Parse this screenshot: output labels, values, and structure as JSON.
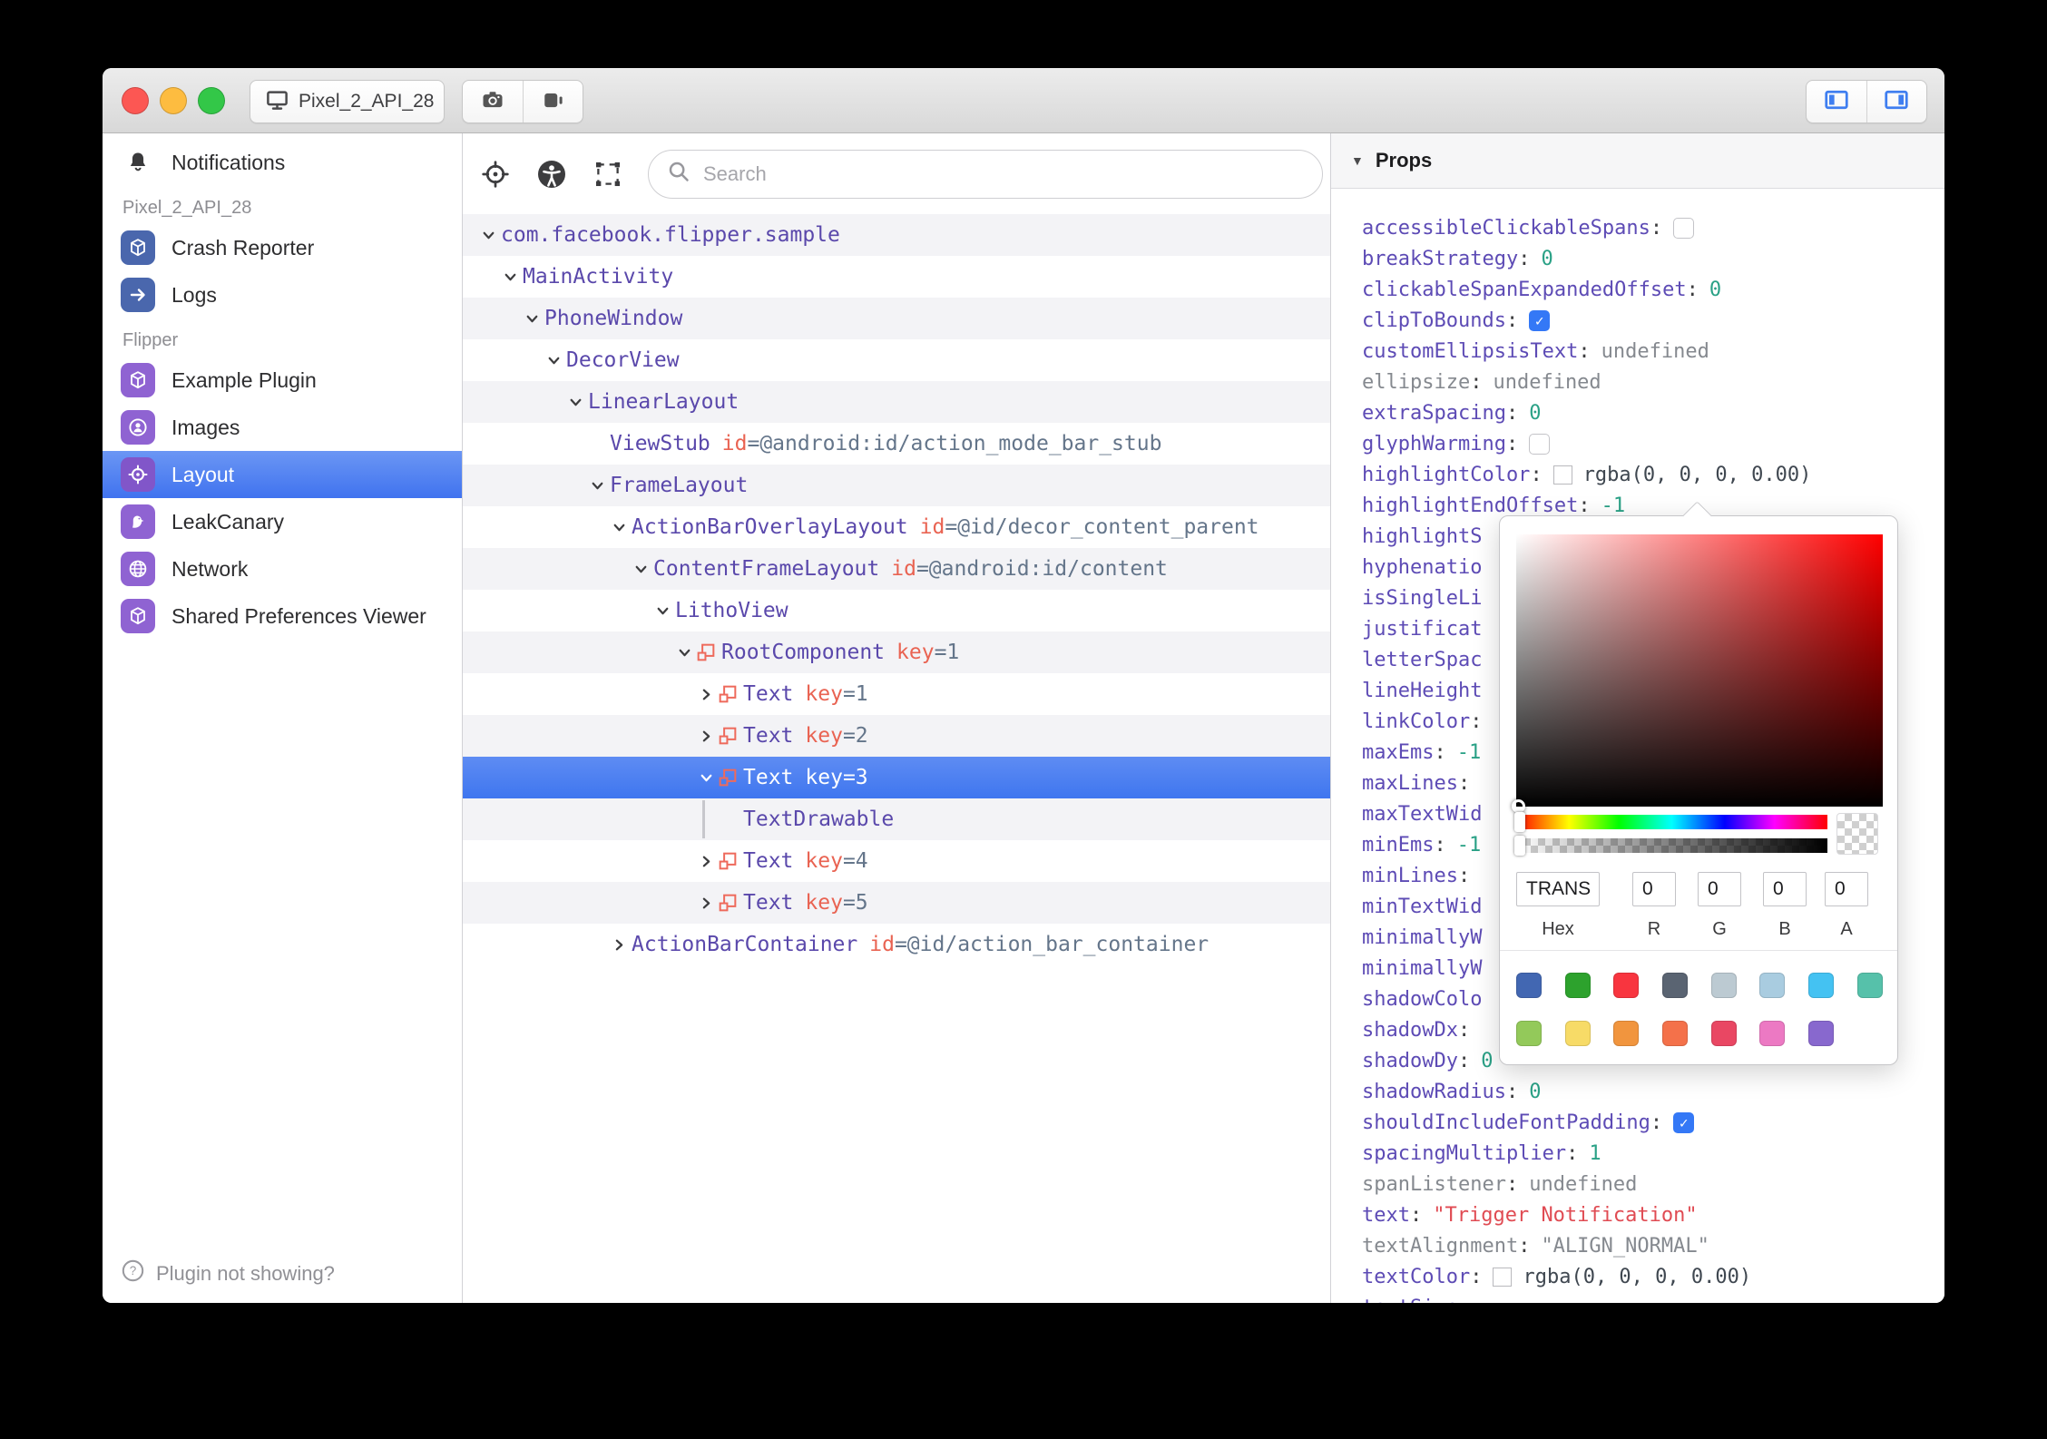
{
  "window": {
    "title_button": "Pixel_2_API_28",
    "traffic_lights": [
      "close",
      "minimize",
      "zoom"
    ],
    "titlebar_icons": [
      "camera-icon",
      "video-camera-icon"
    ],
    "panel_toggles": [
      "toggle-left-panel-icon",
      "toggle-right-panel-icon"
    ]
  },
  "sidebar": {
    "notifications_label": "Notifications",
    "device_section": "Pixel_2_API_28",
    "device_plugins": [
      {
        "label": "Crash Reporter",
        "icon": "cube-icon",
        "color": "#4a67ad"
      },
      {
        "label": "Logs",
        "icon": "arrow-right-icon",
        "color": "#4a67ad"
      }
    ],
    "flipper_section": "Flipper",
    "flipper_plugins": [
      {
        "label": "Example Plugin",
        "icon": "cube-icon",
        "color": "#8f63d2"
      },
      {
        "label": "Images",
        "icon": "person-circle-icon",
        "color": "#8f63d2"
      },
      {
        "label": "Layout",
        "icon": "target-icon",
        "color": "#8156c9",
        "selected": true
      },
      {
        "label": "LeakCanary",
        "icon": "bird-icon",
        "color": "#8f63d2"
      },
      {
        "label": "Network",
        "icon": "globe-icon",
        "color": "#8f63d2"
      },
      {
        "label": "Shared Preferences Viewer",
        "icon": "cube-icon",
        "color": "#8f63d2"
      }
    ],
    "footer": "Plugin not showing?"
  },
  "inspector": {
    "toolbar_icons": [
      "crosshair-icon",
      "accessibility-icon",
      "select-area-icon"
    ],
    "search_placeholder": "Search",
    "tree": [
      {
        "name": "com.facebook.flipper.sample",
        "depth": 0,
        "chevron": "down"
      },
      {
        "name": "MainActivity",
        "depth": 1,
        "chevron": "down"
      },
      {
        "name": "PhoneWindow",
        "depth": 2,
        "chevron": "down"
      },
      {
        "name": "DecorView",
        "depth": 3,
        "chevron": "down"
      },
      {
        "name": "LinearLayout",
        "depth": 4,
        "chevron": "down"
      },
      {
        "name": "ViewStub",
        "depth": 5,
        "chevron": "none",
        "attrs": [
          {
            "key": "id",
            "value": "=@android:id/action_mode_bar_stub"
          }
        ]
      },
      {
        "name": "FrameLayout",
        "depth": 5,
        "chevron": "down"
      },
      {
        "name": "ActionBarOverlayLayout",
        "depth": 6,
        "chevron": "down",
        "attrs": [
          {
            "key": "id",
            "value": "=@id/decor_content_parent"
          }
        ]
      },
      {
        "name": "ContentFrameLayout",
        "depth": 7,
        "chevron": "down",
        "attrs": [
          {
            "key": "id",
            "value": "=@android:id/content"
          }
        ]
      },
      {
        "name": "LithoView",
        "depth": 8,
        "chevron": "down"
      },
      {
        "name": "RootComponent",
        "depth": 9,
        "chevron": "down",
        "litho": true,
        "attrs": [
          {
            "key": "key",
            "value": "=1"
          }
        ]
      },
      {
        "name": "Text",
        "depth": 10,
        "chevron": "right",
        "litho": true,
        "attrs": [
          {
            "key": "key",
            "value": "=1"
          }
        ]
      },
      {
        "name": "Text",
        "depth": 10,
        "chevron": "right",
        "litho": true,
        "attrs": [
          {
            "key": "key",
            "value": "=2"
          }
        ]
      },
      {
        "name": "Text",
        "depth": 10,
        "chevron": "down",
        "litho": true,
        "selected": true,
        "attrs": [
          {
            "key": "key",
            "value": "=3"
          }
        ]
      },
      {
        "name": "TextDrawable",
        "depth": 10,
        "chevron": "pipe"
      },
      {
        "name": "Text",
        "depth": 10,
        "chevron": "right",
        "litho": true,
        "attrs": [
          {
            "key": "key",
            "value": "=4"
          }
        ]
      },
      {
        "name": "Text",
        "depth": 10,
        "chevron": "right",
        "litho": true,
        "attrs": [
          {
            "key": "key",
            "value": "=5"
          }
        ]
      },
      {
        "name": "ActionBarContainer",
        "depth": 6,
        "chevron": "right",
        "attrs": [
          {
            "key": "id",
            "value": "=@id/action_bar_container"
          }
        ]
      }
    ]
  },
  "props_panel": {
    "header": "Props",
    "rows": [
      {
        "name": "accessibleClickableSpans",
        "colon": true,
        "type": "checkbox",
        "checked": false
      },
      {
        "name": "breakStrategy",
        "colon": true,
        "type": "number",
        "value": "0"
      },
      {
        "name": "clickableSpanExpandedOffset",
        "colon": true,
        "type": "number",
        "value": "0"
      },
      {
        "name": "clipToBounds",
        "colon": true,
        "type": "checkbox",
        "checked": true
      },
      {
        "name": "customEllipsisText",
        "colon": true,
        "type": "undefined",
        "value": "undefined"
      },
      {
        "name": "ellipsize",
        "colon": true,
        "type": "undefined",
        "value": "undefined",
        "muted": true
      },
      {
        "name": "extraSpacing",
        "colon": true,
        "type": "number",
        "value": "0"
      },
      {
        "name": "glyphWarming",
        "colon": true,
        "type": "checkbox",
        "checked": false
      },
      {
        "name": "highlightColor",
        "colon": true,
        "type": "color",
        "value": "rgba(0, 0, 0, 0.00)"
      },
      {
        "name": "highlightEndOffset",
        "colon": true,
        "type": "number",
        "value": "-1"
      },
      {
        "name": "highlightS",
        "colon": false,
        "type": "none"
      },
      {
        "name": "hyphenatio",
        "colon": false,
        "type": "none"
      },
      {
        "name": "isSingleLi",
        "colon": false,
        "type": "none"
      },
      {
        "name": "justificat",
        "colon": false,
        "type": "none"
      },
      {
        "name": "letterSpac",
        "colon": false,
        "type": "none"
      },
      {
        "name": "lineHeight",
        "colon": false,
        "type": "none"
      },
      {
        "name": "linkColor",
        "colon": true,
        "type": "none"
      },
      {
        "name": "maxEms",
        "colon": true,
        "type": "number",
        "value": "-1"
      },
      {
        "name": "maxLines",
        "colon": true,
        "type": "none"
      },
      {
        "name": "maxTextWid",
        "colon": false,
        "type": "none"
      },
      {
        "name": "minEms",
        "colon": true,
        "type": "number",
        "value": "-1"
      },
      {
        "name": "minLines",
        "colon": true,
        "type": "none"
      },
      {
        "name": "minTextWid",
        "colon": false,
        "type": "none"
      },
      {
        "name": "minimallyW",
        "colon": false,
        "type": "none"
      },
      {
        "name": "minimallyW",
        "colon": false,
        "type": "none"
      },
      {
        "name": "shadowColo",
        "colon": false,
        "type": "none"
      },
      {
        "name": "shadowDx",
        "colon": true,
        "type": "none"
      },
      {
        "name": "shadowDy",
        "colon": true,
        "type": "number",
        "value": "0"
      },
      {
        "name": "shadowRadius",
        "colon": true,
        "type": "number",
        "value": "0"
      },
      {
        "name": "shouldIncludeFontPadding",
        "colon": true,
        "type": "checkbox",
        "checked": true
      },
      {
        "name": "spacingMultiplier",
        "colon": true,
        "type": "number",
        "value": "1"
      },
      {
        "name": "spanListener",
        "colon": true,
        "type": "undefined",
        "value": "undefined",
        "muted": true
      },
      {
        "name": "text",
        "colon": true,
        "type": "string",
        "value": "\"Trigger Notification\""
      },
      {
        "name": "textAlignment",
        "colon": true,
        "type": "undefined",
        "value": "\"ALIGN_NORMAL\"",
        "muted": true
      },
      {
        "name": "textColor",
        "colon": true,
        "type": "color",
        "value": "rgba(0, 0, 0, 0.00)"
      },
      {
        "name": "textSize",
        "colon": true,
        "type": "none"
      }
    ]
  },
  "color_picker": {
    "hex_value": "TRANS",
    "r_value": "0",
    "g_value": "0",
    "b_value": "0",
    "a_value": "0",
    "labels": {
      "hex": "Hex",
      "r": "R",
      "g": "G",
      "b": "B",
      "a": "A"
    },
    "swatches_row1": [
      "#4267b2",
      "#2da22d",
      "#f8353f",
      "#5a6472",
      "#bccad2",
      "#a9cce0",
      "#44c2f2",
      "#56c1aa"
    ],
    "swatches_row2": [
      "#93c95a",
      "#f7db67",
      "#f1953e",
      "#f4714a",
      "#e94763",
      "#ec79c3",
      "#8868ce"
    ]
  }
}
